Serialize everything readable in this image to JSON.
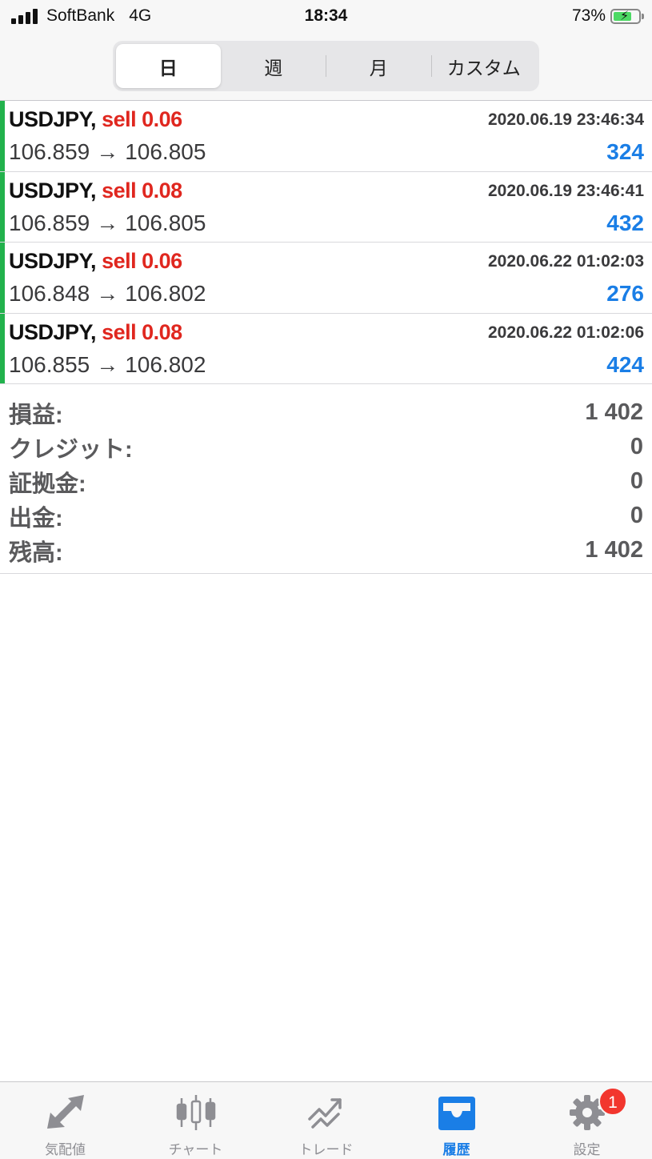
{
  "status_bar": {
    "carrier": "SoftBank",
    "network": "4G",
    "time": "18:34",
    "battery_percent": "73%",
    "battery_level": 0.73
  },
  "period_tabs": [
    {
      "label": "日",
      "active": true
    },
    {
      "label": "週",
      "active": false
    },
    {
      "label": "月",
      "active": false
    },
    {
      "label": "カスタム",
      "active": false
    }
  ],
  "trades": [
    {
      "symbol": "USDJPY,",
      "side": "sell 0.06",
      "time": "2020.06.19 23:46:34",
      "open": "106.859",
      "arrow": "→",
      "close": "106.805",
      "profit": "324"
    },
    {
      "symbol": "USDJPY,",
      "side": "sell 0.08",
      "time": "2020.06.19 23:46:41",
      "open": "106.859",
      "arrow": "→",
      "close": "106.805",
      "profit": "432"
    },
    {
      "symbol": "USDJPY,",
      "side": "sell 0.06",
      "time": "2020.06.22 01:02:03",
      "open": "106.848",
      "arrow": "→",
      "close": "106.802",
      "profit": "276"
    },
    {
      "symbol": "USDJPY,",
      "side": "sell 0.08",
      "time": "2020.06.22 01:02:06",
      "open": "106.855",
      "arrow": "→",
      "close": "106.802",
      "profit": "424"
    }
  ],
  "summary": [
    {
      "label": "損益:",
      "value": "1 402"
    },
    {
      "label": "クレジット:",
      "value": "0"
    },
    {
      "label": "証拠金:",
      "value": "0"
    },
    {
      "label": "出金:",
      "value": "0"
    },
    {
      "label": "残高:",
      "value": "1 402"
    }
  ],
  "tab_bar": [
    {
      "label": "気配値",
      "icon": "quotes-arrows-icon",
      "active": false
    },
    {
      "label": "チャート",
      "icon": "candlestick-chart-icon",
      "active": false
    },
    {
      "label": "トレード",
      "icon": "trade-trend-icon",
      "active": false
    },
    {
      "label": "履歴",
      "icon": "inbox-history-icon",
      "active": true
    },
    {
      "label": "設定",
      "icon": "gear-icon",
      "active": false,
      "badge": "1"
    }
  ],
  "colors": {
    "accent_blue": "#1a7ee6",
    "sell_red": "#e0271f",
    "row_accent_green": "#22b24c",
    "badge_red": "#f2362e"
  }
}
